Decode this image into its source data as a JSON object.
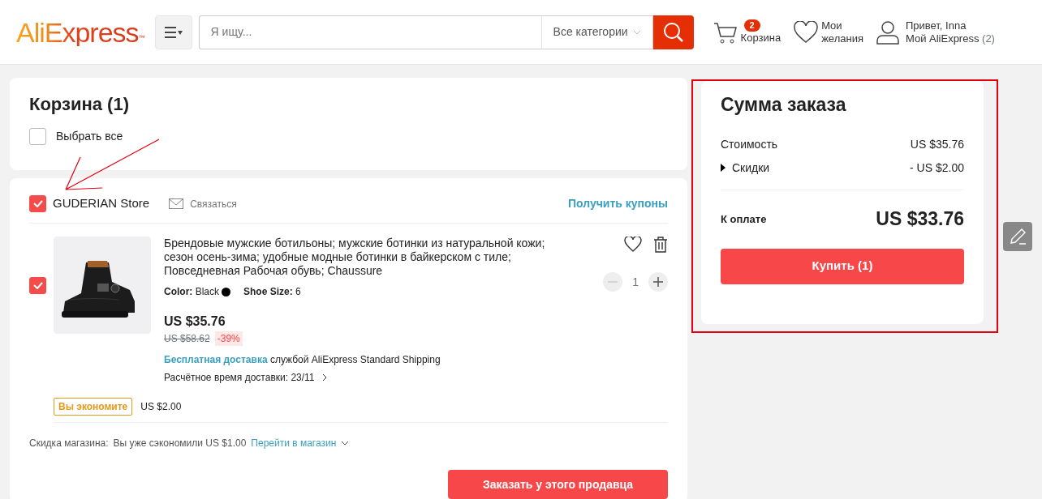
{
  "header": {
    "logo": "AliExpress",
    "logo_mark": "™",
    "search": {
      "placeholder": "Я ищу..."
    },
    "category": "Все категории",
    "cart": {
      "badge": "2",
      "label": "Корзина"
    },
    "wishlist": {
      "line1": "Мои",
      "line2": "желания"
    },
    "account": {
      "greeting": "Привет, Inna",
      "link": "Мой AliExpress",
      "count": "(2)"
    }
  },
  "cart": {
    "title": "Корзина (1)",
    "select_all": {
      "label": "Выбрать все",
      "checked": false
    }
  },
  "store": {
    "name": "GUDERIAN Store",
    "checked": true,
    "contact": "Связаться",
    "coupons": "Получить купоны"
  },
  "item": {
    "checked": true,
    "title": "Брендовые мужские ботильоны; мужские ботинки из натуральной кожи; сезон осень-зима; удобные модные ботинки в байкерском с тиле; Повседневная Рабочая обувь; Chaussure",
    "color_label": "Color:",
    "color_value": "Black",
    "size_label": "Shoe Size:",
    "size_value": "6",
    "price": "US $35.76",
    "old_price": "US $58.62",
    "discount": "-39%",
    "shipping_free": "Бесплатная доставка",
    "shipping_service": "службой AliExpress Standard Shipping",
    "delivery": "Расчётное время доставки: 23/11",
    "quantity": "1"
  },
  "savings": {
    "badge": "Вы экономите",
    "amount": "US $2.00"
  },
  "store_discount": {
    "label": "Скидка магазина:",
    "text": "Вы уже сэкономили US $1.00",
    "link": "Перейти в магазин"
  },
  "order_button": "Заказать у этого продавца",
  "summary": {
    "title": "Сумма заказа",
    "rows": [
      {
        "kind": "plain",
        "label": "Стоимость",
        "value": "US $35.76"
      },
      {
        "kind": "expandable",
        "label": "Скидки",
        "value": "- US $2.00"
      }
    ],
    "total_label": "К оплате",
    "total": "US $33.76",
    "buy_button": "Купить (1)"
  }
}
